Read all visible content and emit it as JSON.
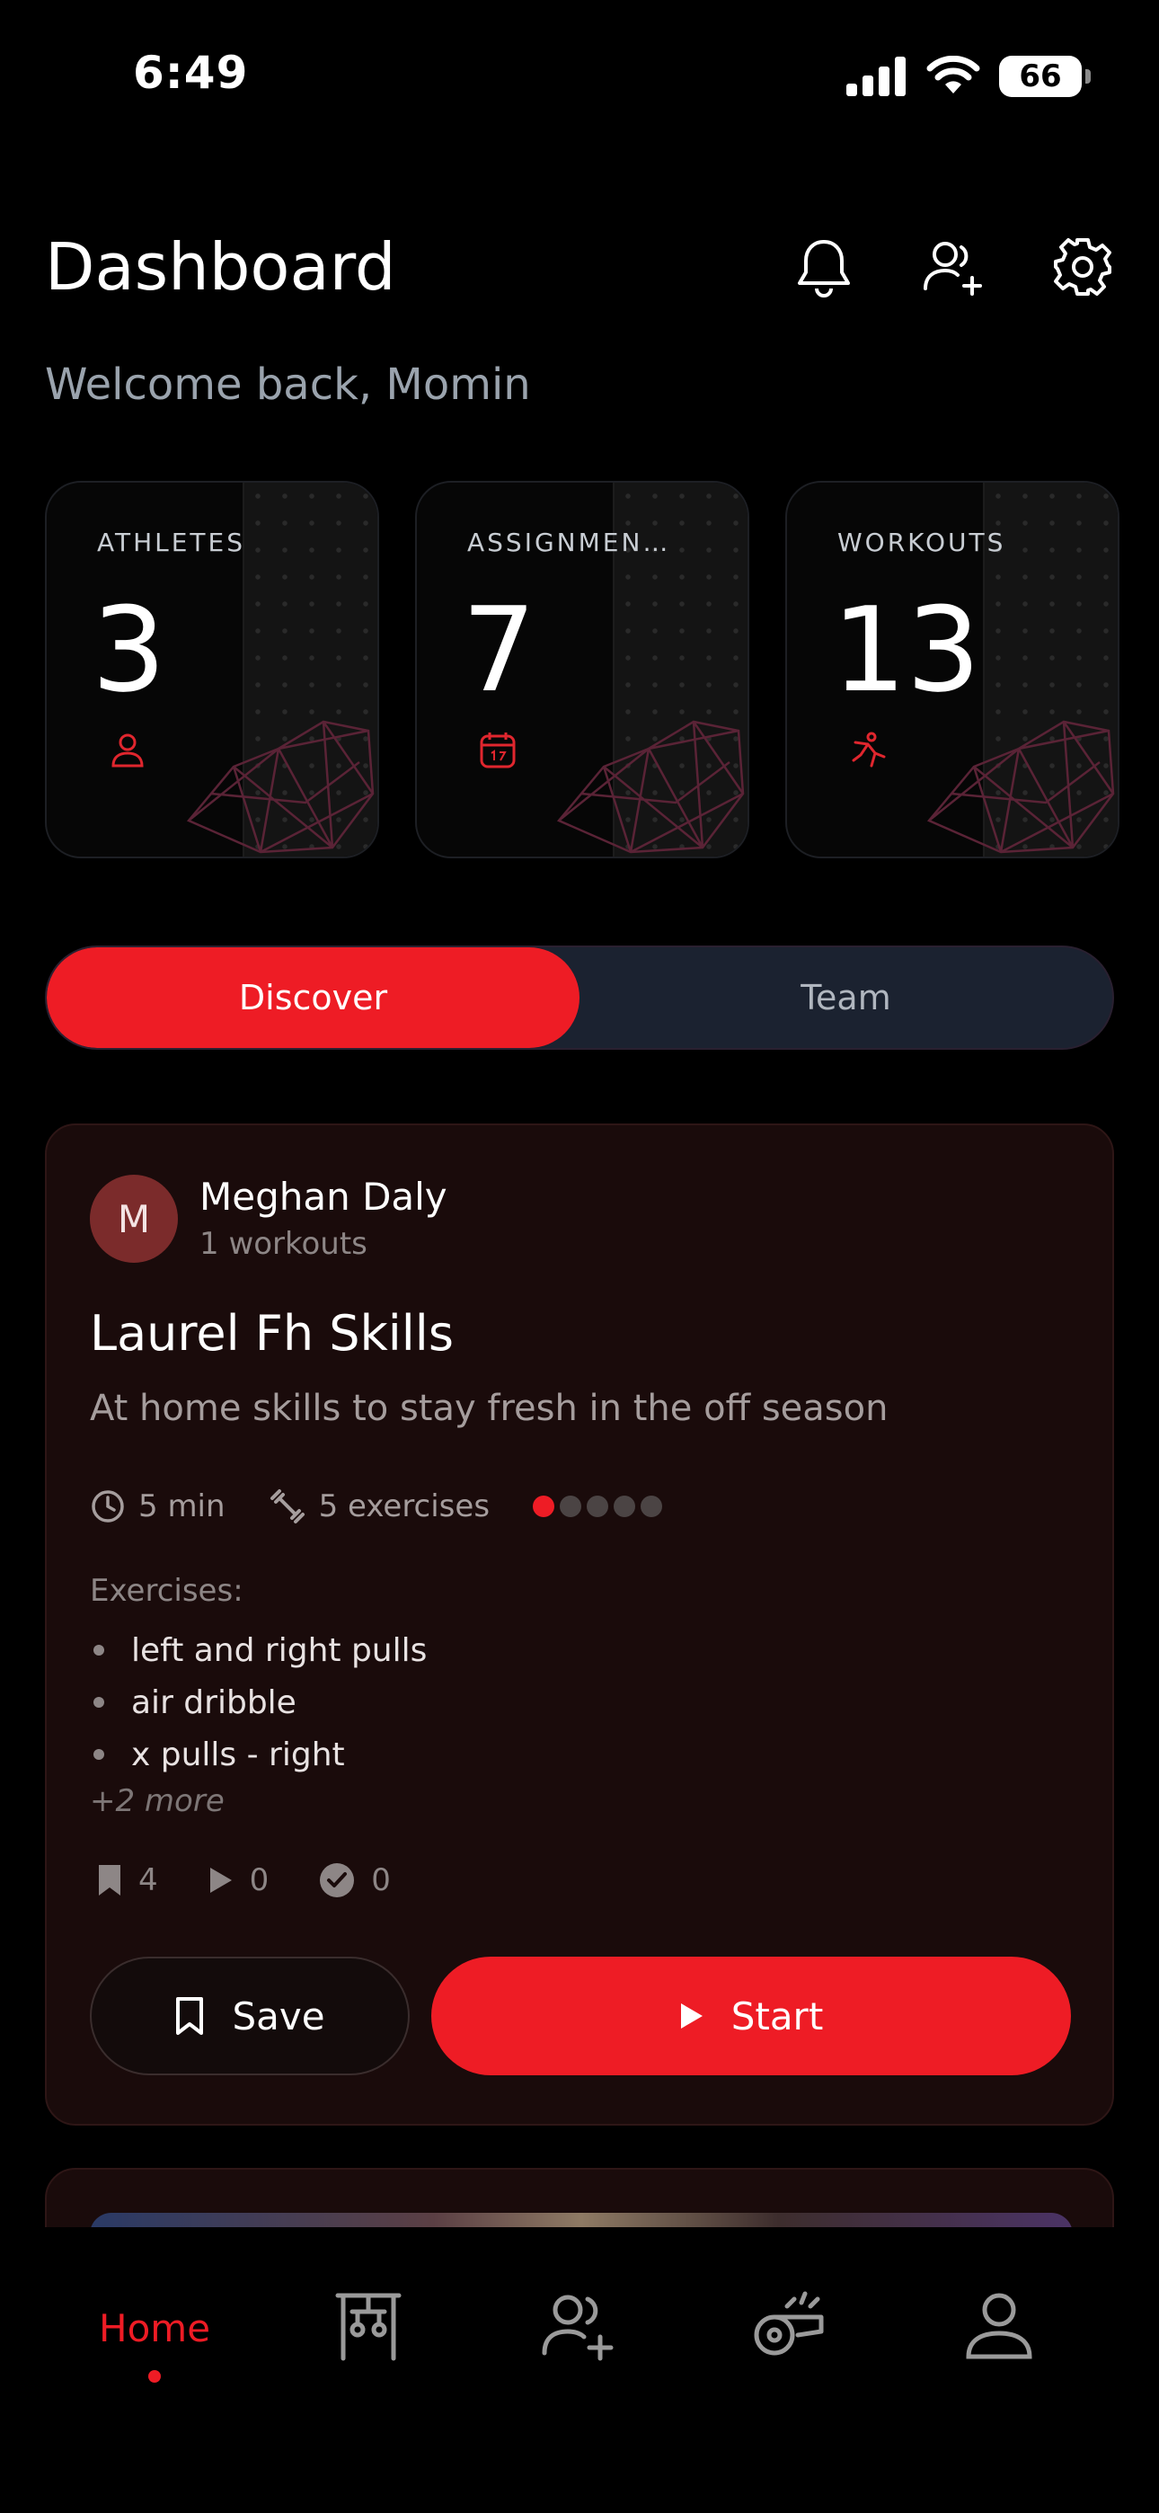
{
  "status_bar": {
    "time": "6:49",
    "battery": "66"
  },
  "header": {
    "title": "Dashboard",
    "welcome": "Welcome back, Momin"
  },
  "stats": [
    {
      "label": "ATHLETES",
      "value": "3",
      "icon": "person-icon"
    },
    {
      "label": "ASSIGNMEN...",
      "value": "7",
      "icon": "calendar-icon"
    },
    {
      "label": "WORKOUTS",
      "value": "13",
      "icon": "athlete-icon"
    }
  ],
  "segmented": {
    "discover": "Discover",
    "team": "Team",
    "active": "Discover"
  },
  "workout_card": {
    "author_initial": "M",
    "author_name": "Meghan Daly",
    "author_sub": "1 workouts",
    "title": "Laurel Fh Skills",
    "description": "At home skills to stay fresh in the off season",
    "duration": "5 min",
    "exercise_count": "5 exercises",
    "difficulty_level": 1,
    "difficulty_max": 5,
    "exercises_label": "Exercises:",
    "exercises": [
      "left and right pulls",
      "air dribble",
      "x pulls - right"
    ],
    "more": "+2 more",
    "saves": "4",
    "plays": "0",
    "completions": "0",
    "save_label": "Save",
    "start_label": "Start"
  },
  "tabbar": {
    "home_label": "Home",
    "active": "home"
  },
  "colors": {
    "accent": "#ee1c25",
    "background": "#000000",
    "card": "#1a0b0b"
  }
}
